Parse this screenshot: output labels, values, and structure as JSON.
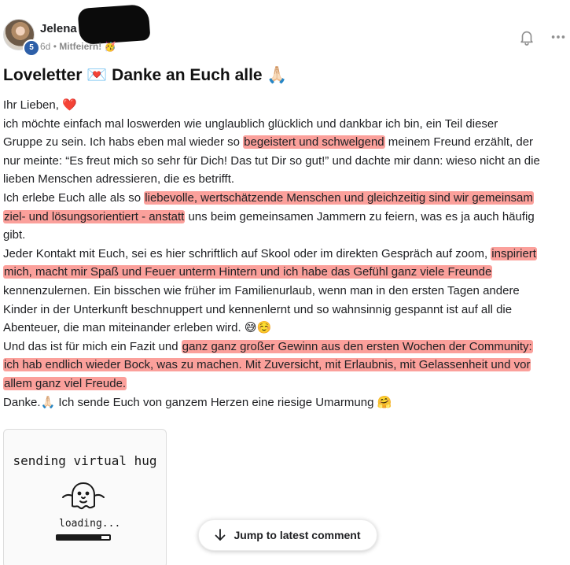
{
  "post": {
    "author": {
      "name": "Jelena Conrad",
      "level": "5"
    },
    "meta": {
      "time": "6d",
      "separator": "•",
      "category": "Mitfeiern!",
      "category_emoji": "🥳"
    },
    "title": "Loveletter 💌 Danke an Euch alle 🙏🏻",
    "body_lines": [
      [
        {
          "t": "Ihr Lieben, ❤️"
        }
      ],
      [
        {
          "t": "ich möchte einfach mal loswerden wie unglaublich glücklich und dankbar ich bin, ein Teil dieser"
        }
      ],
      [
        {
          "t": "Gruppe zu sein. Ich habs eben mal wieder so "
        },
        {
          "t": "begeistert und schwelgend",
          "h": true
        },
        {
          "t": " meinem Freund erzählt, der"
        }
      ],
      [
        {
          "t": "nur meinte: “Es freut mich so sehr für Dich! Das tut Dir so gut!” und dachte mir dann: wieso nicht an die"
        }
      ],
      [
        {
          "t": "lieben Menschen adressieren, die es betrifft."
        }
      ],
      [
        {
          "t": "Ich erlebe Euch alle als so "
        },
        {
          "t": "liebevolle, wertschätzende Menschen und gleichzeitig sind wir gemeinsam",
          "h": true
        }
      ],
      [
        {
          "t": "ziel- und lösungsorientiert - anstatt",
          "h": true
        },
        {
          "t": " uns beim gemeinsamen Jammern zu feiern, was es ja auch häufig"
        }
      ],
      [
        {
          "t": "gibt."
        }
      ],
      [
        {
          "t": "Jeder Kontakt mit Euch, sei es hier schriftlich auf Skool oder im direkten Gespräch auf zoom, "
        },
        {
          "t": "inspiriert",
          "h": true
        }
      ],
      [
        {
          "t": "mich, macht mir Spaß und Feuer unterm Hintern und ich habe das Gefühl ganz viele Freunde",
          "h": true
        }
      ],
      [
        {
          "t": "kennenzulernen. Ein bisschen wie früher im Familienurlaub, wenn man in den ersten Tagen andere"
        }
      ],
      [
        {
          "t": "Kinder in der Unterkunft beschnuppert und kennenlernt und so wahnsinnig gespannt ist auf all die"
        }
      ],
      [
        {
          "t": "Abenteuer, die man miteinander erleben wird. 😅☺️"
        }
      ],
      [
        {
          "t": "Und das ist für mich ein Fazit und "
        },
        {
          "t": "ganz ganz großer Gewinn aus den ersten Wochen der Community:",
          "h": true
        }
      ],
      [
        {
          "t": "ich hab endlich wieder Bock, was zu machen. Mit Zuversicht, mit Erlaubnis, mit Gelassenheit und vor",
          "h": true
        }
      ],
      [
        {
          "t": "allem ganz viel Freude.",
          "h": true
        }
      ],
      [
        {
          "t": "Danke.🙏🏻 Ich sende Euch von ganzem Herzen eine riesige Umarmung 🤗"
        }
      ]
    ],
    "attachment": {
      "title": "sending virtual hug",
      "loading_text": "loading...",
      "progress": 0.85
    }
  },
  "actions": {
    "jump_label": "Jump to latest comment"
  },
  "colors": {
    "highlight": "#f75248",
    "badge": "#2d5fa8"
  },
  "icons": {
    "bell": "bell-icon",
    "more": "more-horizontal-icon",
    "jump": "arrow-down-icon"
  }
}
